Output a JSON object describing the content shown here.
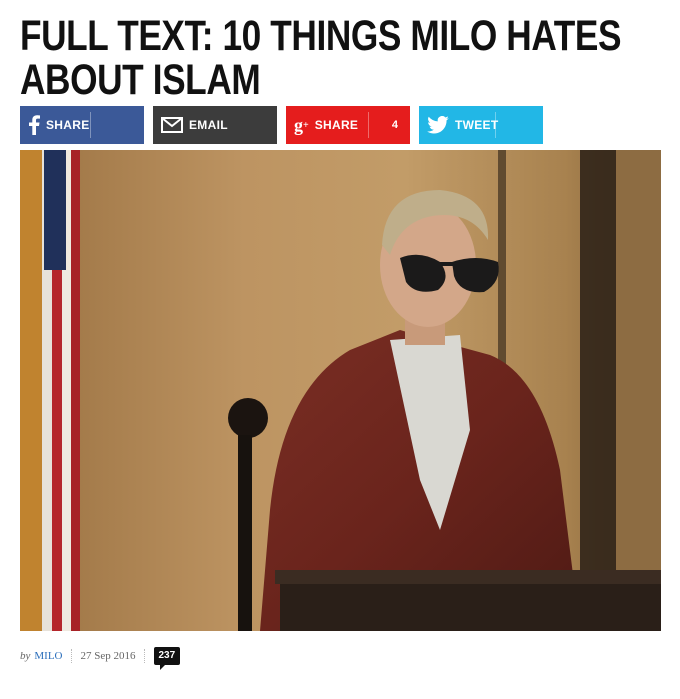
{
  "article": {
    "title": "FULL TEXT: 10 THINGS MILO HATES ABOUT ISLAM"
  },
  "share": {
    "facebook": {
      "label": "SHARE",
      "icon": "facebook-icon",
      "color": "#3b5998"
    },
    "email": {
      "label": "EMAIL",
      "icon": "mail-icon",
      "color": "#3c3c3c"
    },
    "googleplus": {
      "label": "SHARE",
      "icon": "google-plus-icon",
      "count": "4",
      "color": "#e51d1d"
    },
    "twitter": {
      "label": "TWEET",
      "icon": "twitter-bird-icon",
      "color": "#22b7e6"
    }
  },
  "byline": {
    "by": "by",
    "author": "MILO",
    "date": "27 Sep 2016",
    "comments": "237"
  }
}
